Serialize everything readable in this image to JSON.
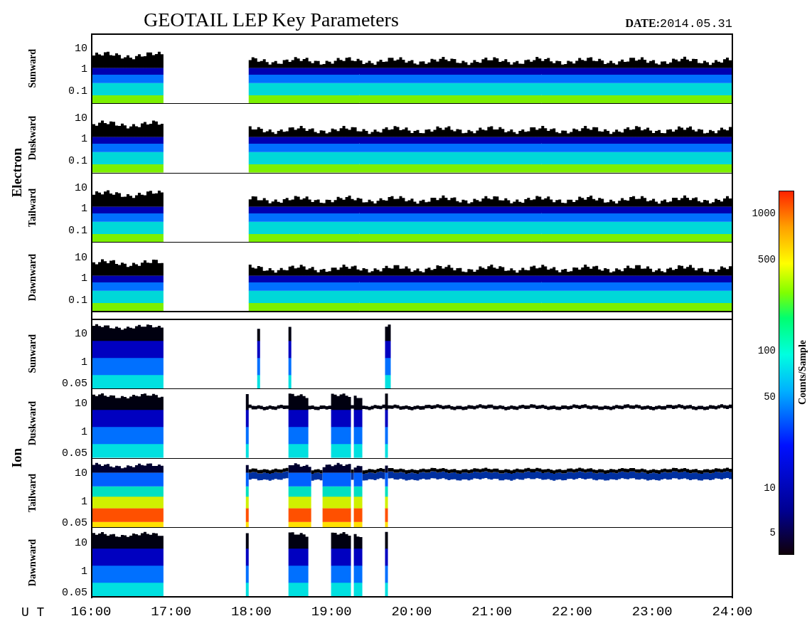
{
  "title": "GEOTAIL LEP Key Parameters",
  "date": {
    "label": "DATE:",
    "value": "2014.05.31"
  },
  "groups": [
    {
      "label": "Electron",
      "panels": [
        {
          "label": "Sunward",
          "yticks": [
            "10",
            "1",
            "0.1"
          ]
        },
        {
          "label": "Duskward",
          "yticks": [
            "10",
            "1",
            "0.1"
          ]
        },
        {
          "label": "Tailward",
          "yticks": [
            "10",
            "1",
            "0.1"
          ]
        },
        {
          "label": "Dawnward",
          "yticks": [
            "10",
            "1",
            "0.1"
          ]
        }
      ]
    },
    {
      "label": "Ion",
      "panels": [
        {
          "label": "Sunward",
          "yticks": [
            "10",
            "1",
            "0.05"
          ]
        },
        {
          "label": "Duskward",
          "yticks": [
            "10",
            "1",
            "0.05"
          ]
        },
        {
          "label": "Tailward",
          "yticks": [
            "10",
            "1",
            "0.05"
          ]
        },
        {
          "label": "Dawnward",
          "yticks": [
            "10",
            "1",
            "0.05"
          ]
        }
      ]
    }
  ],
  "x_axis": {
    "label": "U T",
    "ticks": [
      "16:00",
      "17:00",
      "18:00",
      "19:00",
      "20:00",
      "21:00",
      "22:00",
      "23:00",
      "24:00"
    ]
  },
  "colorbar": {
    "title": "Counts/Sample",
    "ticks": [
      "1000",
      "500",
      "100",
      "50",
      "10",
      "5"
    ]
  }
}
